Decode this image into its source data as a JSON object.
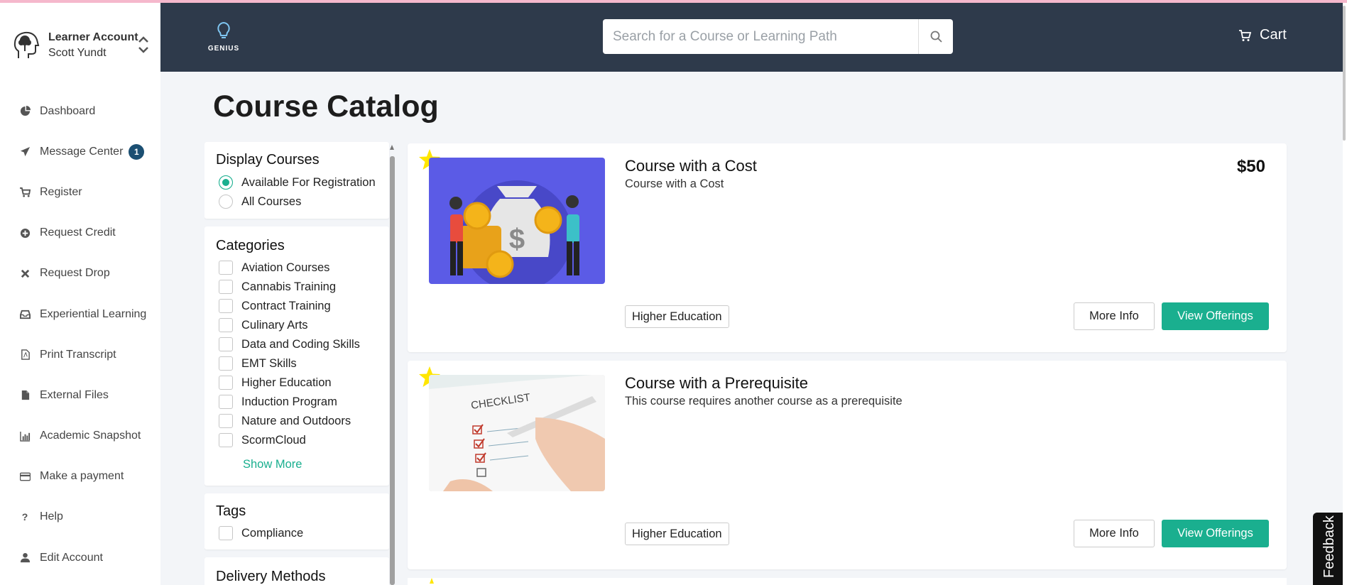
{
  "sidebar": {
    "account_title": "Learner Account",
    "account_name": "Scott Yundt",
    "items": [
      {
        "label": "Dashboard",
        "icon": "pie-chart-icon"
      },
      {
        "label": "Message Center",
        "icon": "paper-plane-icon",
        "badge": "1"
      },
      {
        "label": "Register",
        "icon": "cart-icon"
      },
      {
        "label": "Request Credit",
        "icon": "plus-circle-icon"
      },
      {
        "label": "Request Drop",
        "icon": "x-icon"
      },
      {
        "label": "Experiential Learning",
        "icon": "inbox-icon"
      },
      {
        "label": "Print Transcript",
        "icon": "pdf-file-icon"
      },
      {
        "label": "External Files",
        "icon": "file-icon"
      },
      {
        "label": "Academic Snapshot",
        "icon": "bar-chart-icon"
      },
      {
        "label": "Make a payment",
        "icon": "credit-card-icon"
      },
      {
        "label": "Help",
        "icon": "question-icon"
      },
      {
        "label": "Edit Account",
        "icon": "user-icon"
      }
    ]
  },
  "header": {
    "logo_text": "GENIUS",
    "search_placeholder": "Search for a Course or Learning Path",
    "cart_label": "Cart"
  },
  "main": {
    "title": "Course Catalog"
  },
  "filters": {
    "display": {
      "heading": "Display Courses",
      "options": [
        "Available For Registration",
        "All Courses"
      ],
      "selected": "Available For Registration"
    },
    "categories": {
      "heading": "Categories",
      "options": [
        "Aviation Courses",
        "Cannabis Training",
        "Contract Training",
        "Culinary Arts",
        "Data and Coding Skills",
        "EMT Skills",
        "Higher Education",
        "Induction Program",
        "Nature and Outdoors",
        "ScormCloud"
      ],
      "show_more": "Show More"
    },
    "tags": {
      "heading": "Tags",
      "options": [
        "Compliance"
      ]
    },
    "delivery": {
      "heading": "Delivery Methods"
    }
  },
  "courses": [
    {
      "title": "Course with a Cost",
      "subtitle": "Course with a Cost",
      "price": "$50",
      "tag": "Higher Education",
      "more_info": "More Info",
      "view_offerings": "View Offerings"
    },
    {
      "title": "Course with a Prerequisite",
      "subtitle": "This course requires another course as a prerequisite",
      "price": "",
      "tag": "Higher Education",
      "more_info": "More Info",
      "view_offerings": "View Offerings"
    }
  ],
  "feedback_label": "Feedback",
  "colors": {
    "header_bg": "#2e3a4b",
    "accent": "#1aaf8f",
    "badge": "#1b4f72",
    "star": "#ffe600"
  }
}
